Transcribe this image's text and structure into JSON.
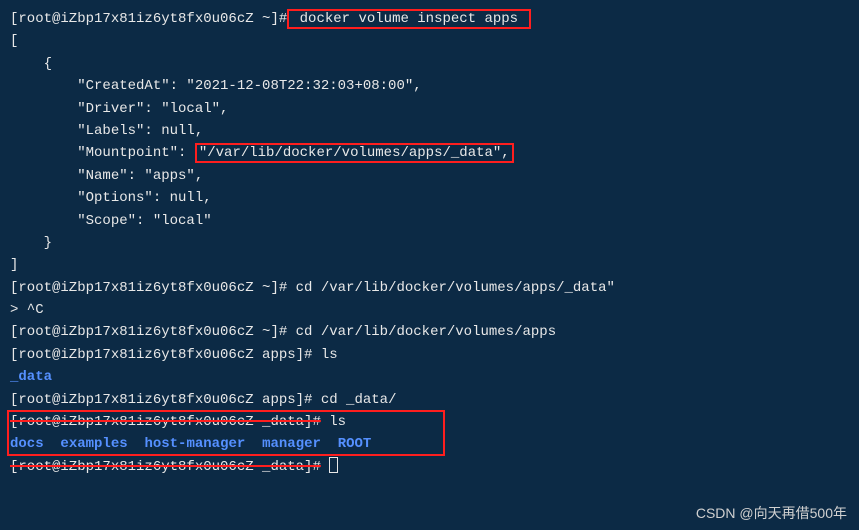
{
  "terminal": {
    "line1_prompt": "[root@iZbp17x81iz6yt8fx0u06cZ ~]#",
    "line1_cmd": " docker volume inspect apps ",
    "line2": "[",
    "line3": "    {",
    "line4": "        \"CreatedAt\": \"2021-12-08T22:32:03+08:00\",",
    "line5": "        \"Driver\": \"local\",",
    "line6": "        \"Labels\": null,",
    "line7_key": "        \"Mountpoint\": ",
    "line7_val": "\"/var/lib/docker/volumes/apps/_data\",",
    "line8": "        \"Name\": \"apps\",",
    "line9": "        \"Options\": null,",
    "line10": "        \"Scope\": \"local\"",
    "line11": "    }",
    "line12": "]",
    "line13_prompt": "[root@iZbp17x81iz6yt8fx0u06cZ ~]#",
    "line13_cmd": " cd /var/lib/docker/volumes/apps/_data\"",
    "line14": "> ^C",
    "line15_prompt": "[root@iZbp17x81iz6yt8fx0u06cZ ~]#",
    "line15_cmd": " cd /var/lib/docker/volumes/apps",
    "line16_prompt": "[root@iZbp17x81iz6yt8fx0u06cZ apps]#",
    "line16_cmd": " ls",
    "line17": "_data",
    "line18_prompt": "[root@iZbp17x81iz6yt8fx0u06cZ apps]#",
    "line18_cmd": " cd _data/",
    "line19_prompt": "[root@iZbp17x81iz6yt8fx0u06cZ _data]#",
    "line19_cmd": " ls",
    "line20_docs": "docs",
    "line20_examples": "examples",
    "line20_host": "host-manager",
    "line20_manager": "manager",
    "line20_root": "ROOT",
    "line21_prompt": "[root@iZbp17x81iz6yt8fx0u06cZ _data]#",
    "sep": "  "
  },
  "watermark": "CSDN @向天再借500年"
}
